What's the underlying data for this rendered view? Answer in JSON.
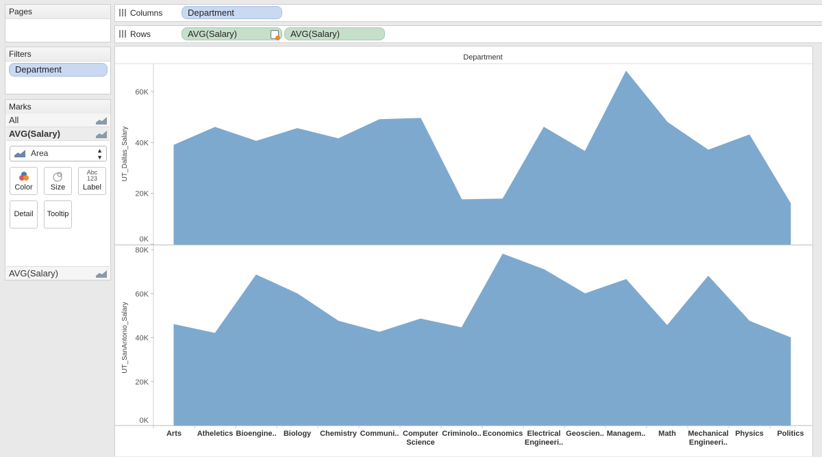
{
  "sidebar": {
    "pages_title": "Pages",
    "filters_title": "Filters",
    "filter_pill": "Department",
    "marks_title": "Marks",
    "marks_all": "All",
    "marks_measure": "AVG(Salary)",
    "mark_type": "Area",
    "buttons": {
      "color": "Color",
      "size": "Size",
      "label": "Label",
      "label_icon_top": "Abc",
      "label_icon_bottom": "123",
      "detail": "Detail",
      "tooltip": "Tooltip"
    },
    "bottom_measure": "AVG(Salary)"
  },
  "shelves": {
    "columns_label": "Columns",
    "columns_pill": "Department",
    "rows_label": "Rows",
    "rows_pills": [
      "AVG(Salary)",
      "AVG(Salary)"
    ]
  },
  "colors": {
    "area": "#7ea9cf",
    "area_stroke": "#5e8fbf",
    "pill_blue": "#c9d9f2",
    "pill_green": "#c6dfcb"
  },
  "chart_data": {
    "type": "area",
    "title": "Department",
    "categories": [
      "Arts",
      "Atheletics",
      "Bioengine..",
      "Biology",
      "Chemistry",
      "Communi..",
      "Computer Science",
      "Criminolo..",
      "Economics",
      "Electrical Engineeri..",
      "Geoscien..",
      "Managem..",
      "Math",
      "Mechanical Engineeri..",
      "Physics",
      "Politics"
    ],
    "panes": [
      {
        "ylabel": "UT_Dallas_Salary",
        "ylim": [
          0,
          71000
        ],
        "ticks": [
          0,
          20000,
          40000,
          60000
        ],
        "tick_labels": [
          "0K",
          "20K",
          "40K",
          "60K"
        ],
        "values": [
          39000,
          46000,
          40500,
          45500,
          41500,
          49000,
          49500,
          17500,
          17800,
          46000,
          36500,
          68000,
          48000,
          37000,
          43000,
          16000
        ]
      },
      {
        "ylabel": "UT_SanAntonio_Salary",
        "ylim": [
          0,
          80000
        ],
        "ticks": [
          0,
          20000,
          40000,
          60000,
          80000
        ],
        "tick_labels": [
          "0K",
          "20K",
          "40K",
          "60K",
          "80K"
        ],
        "values": [
          46000,
          42000,
          68500,
          60000,
          47500,
          42500,
          48500,
          44500,
          78000,
          71000,
          60000,
          66500,
          45500,
          68000,
          47500,
          40000
        ]
      }
    ],
    "grid": false,
    "legend": "none"
  }
}
